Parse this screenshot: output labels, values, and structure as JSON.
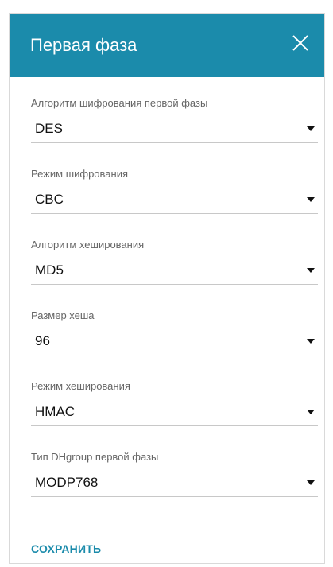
{
  "dialog": {
    "title": "Первая фаза",
    "close_icon": "close-icon"
  },
  "fields": [
    {
      "label": "Алгоритм шифрования первой фазы",
      "value": "DES"
    },
    {
      "label": "Режим шифрования",
      "value": "CBC"
    },
    {
      "label": "Алгоритм хеширования",
      "value": "MD5"
    },
    {
      "label": "Размер хеша",
      "value": "96"
    },
    {
      "label": "Режим хеширования",
      "value": "HMAC"
    },
    {
      "label": "Тип DHgroup первой фазы",
      "value": "MODP768"
    }
  ],
  "actions": {
    "save_label": "СОХРАНИТЬ"
  },
  "colors": {
    "header": "#1b8bab",
    "accent": "#1b8bab"
  }
}
